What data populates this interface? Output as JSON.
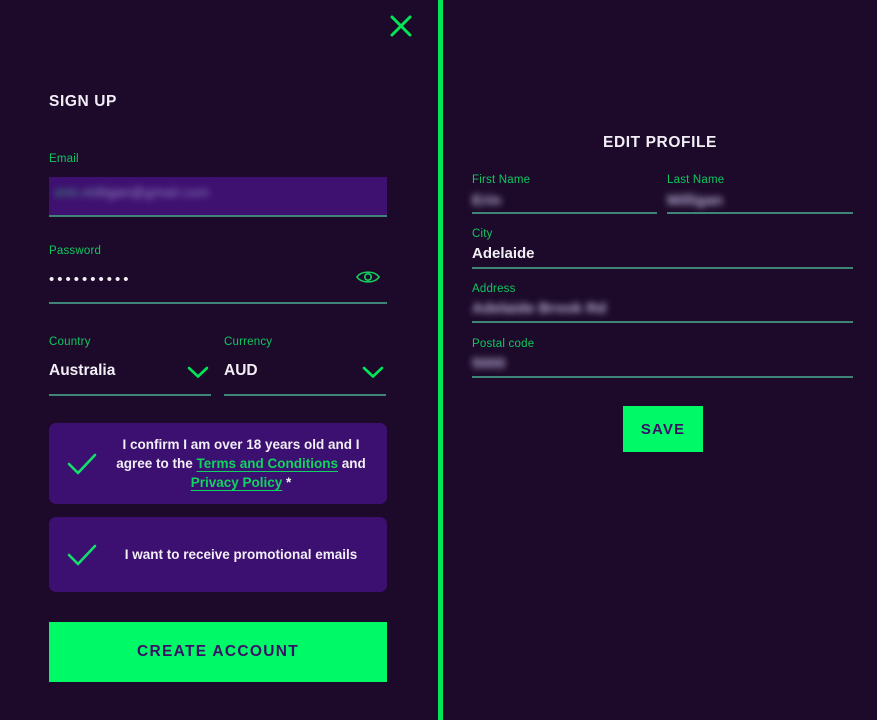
{
  "colors": {
    "background": "#1d0a2a",
    "accent_green": "#00f967",
    "label_green": "#0ec75f",
    "underline_teal": "#3f8478",
    "card_purple": "#3c1070",
    "input_purple": "#3e1070",
    "text_light": "#f2eef6",
    "divider_green": "#00e656"
  },
  "left_panel": {
    "close_icon": "close-icon",
    "heading": "SIGN UP",
    "email": {
      "label": "Email",
      "value": "erin.milligan@gmail.com",
      "redacted": true
    },
    "password": {
      "label": "Password",
      "value": "••••••••••",
      "reveal_icon": "eye-icon"
    },
    "country": {
      "label": "Country",
      "value": "Australia",
      "chevron_icon": "chevron-down-icon"
    },
    "currency": {
      "label": "Currency",
      "value": "AUD",
      "chevron_icon": "chevron-down-icon"
    },
    "consent": {
      "checked": true,
      "check_icon": "checkmark-icon",
      "text_part_1": "I confirm I am over 18 years old and I agree to the ",
      "link_terms": "Terms and Conditions",
      "text_part_2": " and ",
      "link_privacy": "Privacy Policy",
      "required_mark": " *"
    },
    "promo": {
      "checked": true,
      "check_icon": "checkmark-icon",
      "text": "I want to receive promotional emails"
    },
    "submit_label": "CREATE ACCOUNT"
  },
  "right_panel": {
    "close_icon": "close-icon",
    "heading": "EDIT PROFILE",
    "fields": [
      {
        "label": "First Name",
        "value": "Erin",
        "redacted": true
      },
      {
        "label": "Last Name",
        "value": "Milligan",
        "redacted": true
      },
      {
        "label": "City",
        "value": "Adelaide",
        "redacted": false
      },
      {
        "label": "Address",
        "value": "Adelaide Brook Rd",
        "redacted": true
      },
      {
        "label": "Postal code",
        "value": "5000",
        "redacted": true
      }
    ],
    "save_label": "SAVE"
  }
}
